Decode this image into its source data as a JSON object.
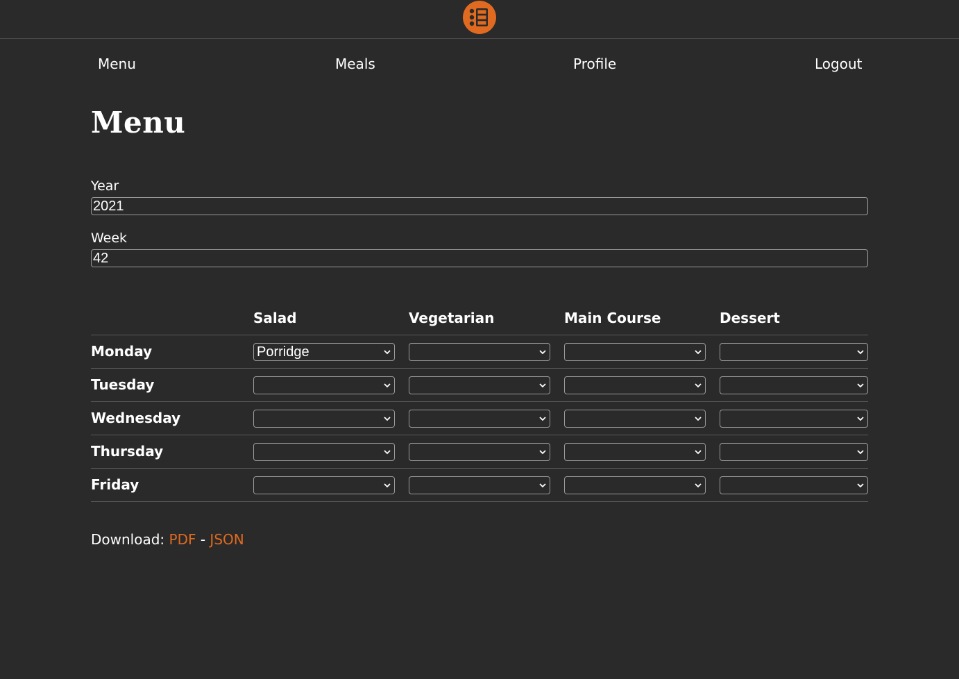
{
  "header": {
    "logo_icon": "menu-list-icon",
    "accent_color": "#e06a1f"
  },
  "nav": {
    "menu": "Menu",
    "meals": "Meals",
    "profile": "Profile",
    "logout": "Logout"
  },
  "page": {
    "title": "Menu"
  },
  "form": {
    "year_label": "Year",
    "year_value": "2021",
    "week_label": "Week",
    "week_value": "42"
  },
  "table": {
    "columns": [
      "Salad",
      "Vegetarian",
      "Main Course",
      "Dessert"
    ],
    "rows": [
      {
        "day": "Monday",
        "values": [
          "Porridge",
          "",
          "",
          ""
        ]
      },
      {
        "day": "Tuesday",
        "values": [
          "",
          "",
          "",
          ""
        ]
      },
      {
        "day": "Wednesday",
        "values": [
          "",
          "",
          "",
          ""
        ]
      },
      {
        "day": "Thursday",
        "values": [
          "",
          "",
          "",
          ""
        ]
      },
      {
        "day": "Friday",
        "values": [
          "",
          "",
          "",
          ""
        ]
      }
    ]
  },
  "download": {
    "label": "Download:",
    "pdf": "PDF",
    "separator": "-",
    "json": "JSON"
  }
}
